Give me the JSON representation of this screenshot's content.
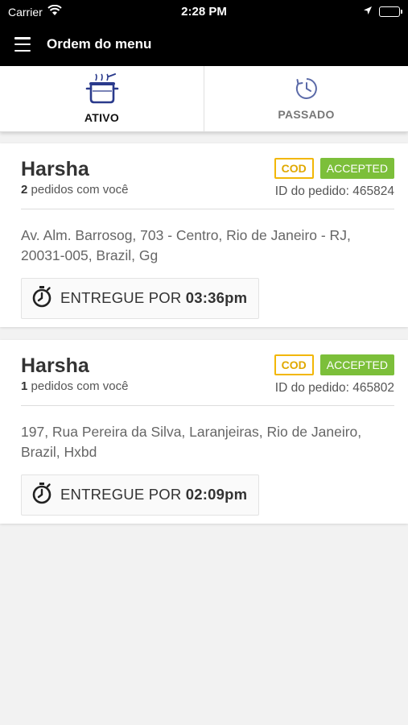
{
  "status_bar": {
    "carrier": "Carrier",
    "time": "2:28 PM"
  },
  "header": {
    "title": "Ordem do menu"
  },
  "tabs": [
    {
      "label": "ATIVO",
      "icon": "pot-icon",
      "active": true
    },
    {
      "label": "PASSADO",
      "icon": "clock-history-icon",
      "active": false
    }
  ],
  "colors": {
    "accent_cod": "#f2b705",
    "accepted_green": "#7cbf3a",
    "header_bg": "#000000",
    "tab_icon_active": "#2a3a8c",
    "tab_icon_inactive": "#5b6aa8"
  },
  "orders": [
    {
      "customer": "Harsha",
      "count": "2",
      "count_suffix": " pedidos com você",
      "payment_badge": "COD",
      "status_badge": "ACCEPTED",
      "order_id": "ID do pedido: 465824",
      "address": "Av. Alm. Barrosog, 703 - Centro, Rio de Janeiro - RJ, 20031-005, Brazil,  Gg",
      "delivery_label": "ENTREGUE POR",
      "delivery_time": "03:36pm"
    },
    {
      "customer": "Harsha",
      "count": "1",
      "count_suffix": " pedidos com você",
      "payment_badge": "COD",
      "status_badge": "ACCEPTED",
      "order_id": "ID do pedido: 465802",
      "address": "197, Rua Pereira da Silva, Laranjeiras, Rio de Janeiro, Brazil, Hxbd",
      "delivery_label": "ENTREGUE POR",
      "delivery_time": "02:09pm"
    }
  ]
}
